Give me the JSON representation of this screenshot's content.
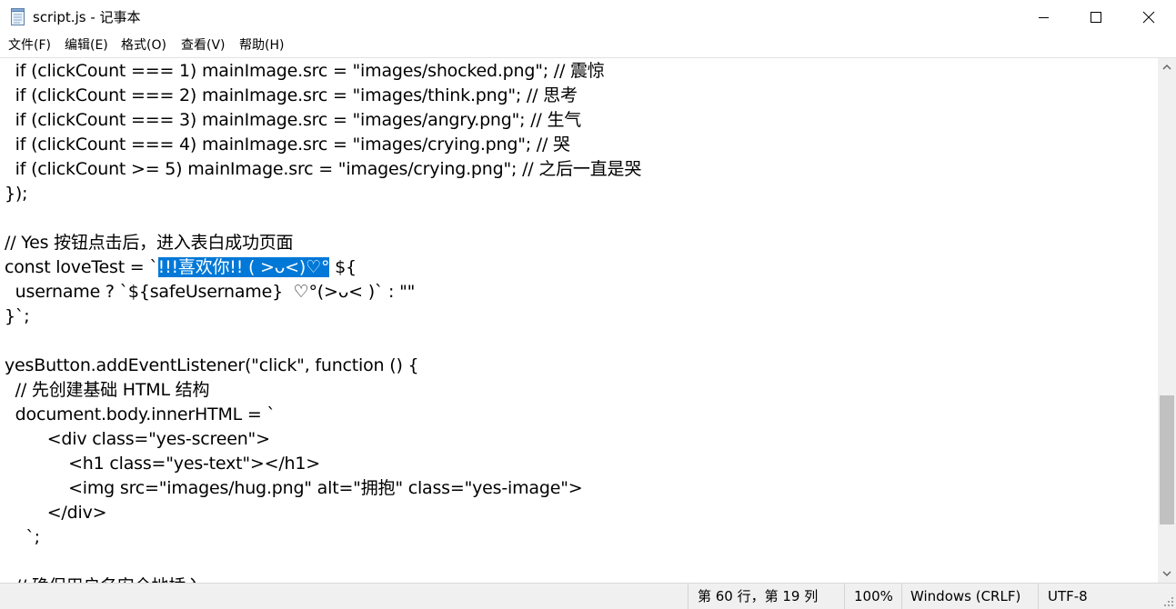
{
  "window": {
    "title": "script.js - 记事本",
    "icon": "notepad-icon",
    "minimize_icon": "minimize-icon",
    "maximize_icon": "maximize-icon",
    "close_icon": "close-icon"
  },
  "menu": {
    "items": [
      {
        "label": "文件(F)"
      },
      {
        "label": "编辑(E)"
      },
      {
        "label": "格式(O)"
      },
      {
        "label": "查看(V)"
      },
      {
        "label": "帮助(H)"
      }
    ]
  },
  "editor": {
    "lines": [
      {
        "text": "  if (clickCount === 1) mainImage.src = \"images/shocked.png\"; // 震惊"
      },
      {
        "text": "  if (clickCount === 2) mainImage.src = \"images/think.png\"; // 思考"
      },
      {
        "text": "  if (clickCount === 3) mainImage.src = \"images/angry.png\"; // 生气"
      },
      {
        "text": "  if (clickCount === 4) mainImage.src = \"images/crying.png\"; // 哭"
      },
      {
        "text": "  if (clickCount >= 5) mainImage.src = \"images/crying.png\"; // 之后一直是哭"
      },
      {
        "text": "});"
      },
      {
        "text": ""
      },
      {
        "text": "// Yes 按钮点击后，进入表白成功页面"
      },
      {
        "before": "const loveTest = `",
        "selected": "!!!喜欢你!! ( >ᴗ<)♡°",
        "after": " ${"
      },
      {
        "text": "  username ? `${safeUsername}  ♡°(>ᴗ< )` : \"\""
      },
      {
        "text": "}`;"
      },
      {
        "text": ""
      },
      {
        "text": "yesButton.addEventListener(\"click\", function () {"
      },
      {
        "text": "  // 先创建基础 HTML 结构"
      },
      {
        "text": "  document.body.innerHTML = `"
      },
      {
        "text": "        <div class=\"yes-screen\">"
      },
      {
        "text": "            <h1 class=\"yes-text\"></h1>"
      },
      {
        "text": "            <img src=\"images/hug.png\" alt=\"拥抱\" class=\"yes-image\">"
      },
      {
        "text": "        </div>"
      },
      {
        "text": "    `;"
      },
      {
        "text": ""
      },
      {
        "text": "  // 确保用户名安全地插入"
      }
    ]
  },
  "scrollbar": {
    "up_icon": "scroll-up-icon",
    "down_icon": "scroll-down-icon"
  },
  "status": {
    "position": "第 60 行，第 19 列",
    "zoom": "100%",
    "line_ending": "Windows (CRLF)",
    "encoding": "UTF-8"
  }
}
